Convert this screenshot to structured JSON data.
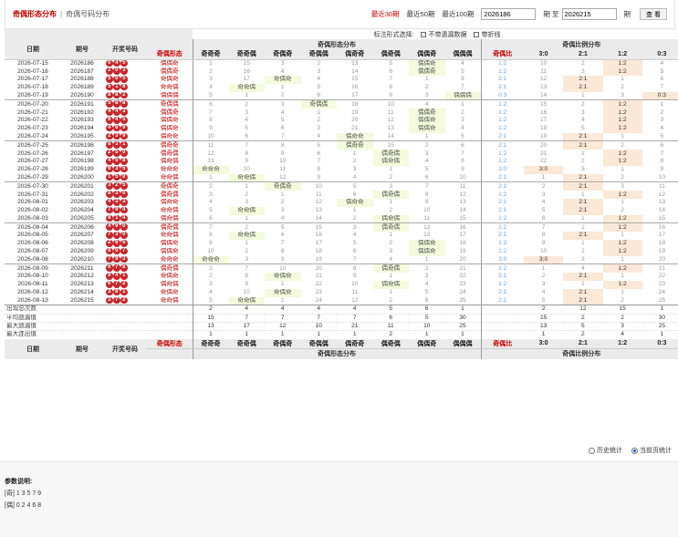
{
  "header": {
    "tab_active": "奇偶形态分布",
    "separator": "|",
    "tab_other": "奇偶号码分布",
    "range_30": "最近30期",
    "range_50": "最近50期",
    "range_100": "最近100期",
    "from_value": "2026186",
    "from_label": "期 至",
    "to_value": "2026215",
    "to_label": "期",
    "query_button": "查 看"
  },
  "columns": {
    "date": "日期",
    "issue": "期号",
    "balls": "开奖号码",
    "form": "奇偶形态",
    "form_group": "奇偶形态分布",
    "form_cols": [
      "奇奇奇",
      "奇奇偶",
      "奇偶奇",
      "奇偶偶",
      "偶奇奇",
      "偶奇偶",
      "偶偶奇",
      "偶偶偶"
    ],
    "ratio_group": "奇偶比例分布",
    "ratio": "奇偶比",
    "ratio_cols": [
      "3:0",
      "2:1",
      "1:2",
      "0:3"
    ]
  },
  "options": {
    "title": "标注形式选择:",
    "opt1": "不带遗漏数据",
    "opt2": "带折线"
  },
  "rows": [
    {
      "date": "2026-07-15",
      "issue": "2026186",
      "balls": [
        "0",
        "4",
        "5"
      ],
      "form": "偶偶奇",
      "f": [
        "1",
        "15",
        "3",
        "2",
        "13",
        "5",
        "偶偶奇",
        "4"
      ],
      "ratio": "1:2",
      "r": [
        "10",
        "2",
        "1:2",
        "4"
      ]
    },
    {
      "date": "2026-07-16",
      "issue": "2026187",
      "balls": [
        "2",
        "0",
        "3"
      ],
      "form": "偶偶奇",
      "f": [
        "2",
        "16",
        "4",
        "3",
        "14",
        "6",
        "偶偶奇",
        "5"
      ],
      "ratio": "1:2",
      "r": [
        "11",
        "3",
        "1:2",
        "5"
      ]
    },
    {
      "date": "2026-07-17",
      "issue": "2026188",
      "balls": [
        "5",
        "0",
        "5"
      ],
      "form": "奇偶奇",
      "f": [
        "3",
        "17",
        "奇偶奇",
        "4",
        "15",
        "7",
        "1",
        "6"
      ],
      "ratio": "2:1",
      "r": [
        "12",
        "2:1",
        "1",
        "6"
      ]
    },
    {
      "date": "2026-07-18",
      "issue": "2026189",
      "balls": [
        "5",
        "1",
        "8"
      ],
      "form": "奇奇偶",
      "f": [
        "4",
        "奇奇偶",
        "1",
        "5",
        "16",
        "8",
        "2",
        "7"
      ],
      "ratio": "2:1",
      "r": [
        "13",
        "2:1",
        "2",
        "7"
      ]
    },
    {
      "date": "2026-07-19",
      "issue": "2026190",
      "balls": [
        "8",
        "8",
        "2"
      ],
      "form": "偶偶偶",
      "f": [
        "5",
        "1",
        "2",
        "6",
        "17",
        "9",
        "3",
        "偶偶偶"
      ],
      "ratio": "0:3",
      "r": [
        "14",
        "1",
        "3",
        "0:3"
      ]
    },
    {
      "date": "2026-07-20",
      "issue": "2026191",
      "balls": [
        "5",
        "8",
        "8"
      ],
      "form": "奇偶偶",
      "f": [
        "6",
        "2",
        "3",
        "奇偶偶",
        "18",
        "10",
        "4",
        "1"
      ],
      "ratio": "1:2",
      "r": [
        "15",
        "2",
        "1:2",
        "1"
      ]
    },
    {
      "date": "2026-07-21",
      "issue": "2026192",
      "balls": [
        "4",
        "4",
        "3"
      ],
      "form": "偶偶奇",
      "f": [
        "7",
        "3",
        "4",
        "1",
        "19",
        "11",
        "偶偶奇",
        "2"
      ],
      "ratio": "1:2",
      "r": [
        "16",
        "3",
        "1:2",
        "2"
      ]
    },
    {
      "date": "2026-07-22",
      "issue": "2026193",
      "balls": [
        "6",
        "4",
        "5"
      ],
      "form": "偶偶奇",
      "f": [
        "8",
        "4",
        "5",
        "2",
        "20",
        "12",
        "偶偶奇",
        "3"
      ],
      "ratio": "1:2",
      "r": [
        "17",
        "4",
        "1:2",
        "3"
      ]
    },
    {
      "date": "2026-07-23",
      "issue": "2026194",
      "balls": [
        "4",
        "6",
        "9"
      ],
      "form": "偶偶奇",
      "f": [
        "9",
        "5",
        "6",
        "3",
        "21",
        "13",
        "偶偶奇",
        "4"
      ],
      "ratio": "1:2",
      "r": [
        "18",
        "5",
        "1:2",
        "4"
      ]
    },
    {
      "date": "2026-07-24",
      "issue": "2026195",
      "balls": [
        "2",
        "3",
        "9"
      ],
      "form": "偶奇奇",
      "f": [
        "10",
        "6",
        "7",
        "4",
        "偶奇奇",
        "14",
        "1",
        "5"
      ],
      "ratio": "2:1",
      "r": [
        "19",
        "2:1",
        "1",
        "5"
      ]
    },
    {
      "date": "2026-07-25",
      "issue": "2026196",
      "balls": [
        "8",
        "3",
        "1"
      ],
      "form": "偶奇奇",
      "f": [
        "11",
        "7",
        "8",
        "5",
        "偶奇奇",
        "15",
        "2",
        "6"
      ],
      "ratio": "2:1",
      "r": [
        "20",
        "2:1",
        "2",
        "6"
      ]
    },
    {
      "date": "2026-07-26",
      "issue": "2026197",
      "balls": [
        "2",
        "5",
        "0"
      ],
      "form": "偶奇偶",
      "f": [
        "12",
        "8",
        "9",
        "6",
        "1",
        "偶奇偶",
        "3",
        "7"
      ],
      "ratio": "1:2",
      "r": [
        "21",
        "1",
        "1:2",
        "7"
      ]
    },
    {
      "date": "2026-07-27",
      "issue": "2026198",
      "balls": [
        "4",
        "5",
        "8"
      ],
      "form": "偶奇偶",
      "f": [
        "13",
        "9",
        "10",
        "7",
        "2",
        "偶奇偶",
        "4",
        "8"
      ],
      "ratio": "1:2",
      "r": [
        "22",
        "2",
        "1:2",
        "8"
      ]
    },
    {
      "date": "2026-07-28",
      "issue": "2026199",
      "balls": [
        "9",
        "3",
        "5"
      ],
      "form": "奇奇奇",
      "f": [
        "奇奇奇",
        "10",
        "11",
        "8",
        "3",
        "1",
        "5",
        "9"
      ],
      "ratio": "3:0",
      "r": [
        "3:0",
        "3",
        "1",
        "9"
      ]
    },
    {
      "date": "2026-07-29",
      "issue": "2026200",
      "balls": [
        "1",
        "5",
        "0"
      ],
      "form": "奇奇偶",
      "f": [
        "1",
        "奇奇偶",
        "12",
        "9",
        "4",
        "2",
        "6",
        "10"
      ],
      "ratio": "2:1",
      "r": [
        "1",
        "2:1",
        "2",
        "10"
      ]
    },
    {
      "date": "2026-07-30",
      "issue": "2026201",
      "balls": [
        "3",
        "2",
        "5"
      ],
      "form": "奇偶奇",
      "f": [
        "2",
        "1",
        "奇偶奇",
        "10",
        "5",
        "3",
        "7",
        "11"
      ],
      "ratio": "2:1",
      "r": [
        "2",
        "2:1",
        "3",
        "11"
      ]
    },
    {
      "date": "2026-07-31",
      "issue": "2026202",
      "balls": [
        "8",
        "3",
        "0"
      ],
      "form": "偶奇偶",
      "f": [
        "3",
        "2",
        "1",
        "11",
        "6",
        "偶奇偶",
        "8",
        "12"
      ],
      "ratio": "1:2",
      "r": [
        "3",
        "1",
        "1:2",
        "12"
      ]
    },
    {
      "date": "2026-08-01",
      "issue": "2026203",
      "balls": [
        "4",
        "3",
        "3"
      ],
      "form": "偶奇奇",
      "f": [
        "4",
        "3",
        "2",
        "12",
        "偶奇奇",
        "1",
        "9",
        "13"
      ],
      "ratio": "2:1",
      "r": [
        "4",
        "2:1",
        "1",
        "13"
      ]
    },
    {
      "date": "2026-08-02",
      "issue": "2026204",
      "balls": [
        "7",
        "9",
        "4"
      ],
      "form": "奇奇偶",
      "f": [
        "5",
        "奇奇偶",
        "3",
        "13",
        "1",
        "2",
        "10",
        "14"
      ],
      "ratio": "2:1",
      "r": [
        "5",
        "2:1",
        "2",
        "14"
      ]
    },
    {
      "date": "2026-08-03",
      "issue": "2026205",
      "balls": [
        "8",
        "1",
        "4"
      ],
      "form": "偶奇偶",
      "f": [
        "6",
        "1",
        "4",
        "14",
        "2",
        "偶奇偶",
        "11",
        "15"
      ],
      "ratio": "1:2",
      "r": [
        "6",
        "1",
        "1:2",
        "15"
      ]
    },
    {
      "date": "2026-08-04",
      "issue": "2026206",
      "balls": [
        "4",
        "9",
        "0"
      ],
      "form": "偶奇偶",
      "f": [
        "7",
        "2",
        "5",
        "15",
        "3",
        "偶奇偶",
        "12",
        "16"
      ],
      "ratio": "1:2",
      "r": [
        "7",
        "2",
        "1:2",
        "16"
      ]
    },
    {
      "date": "2026-08-05",
      "issue": "2026207",
      "balls": [
        "7",
        "3",
        "0"
      ],
      "form": "奇奇偶",
      "f": [
        "8",
        "奇奇偶",
        "6",
        "16",
        "4",
        "1",
        "13",
        "17"
      ],
      "ratio": "2:1",
      "r": [
        "8",
        "2:1",
        "1",
        "17"
      ]
    },
    {
      "date": "2026-08-06",
      "issue": "2026208",
      "balls": [
        "2",
        "6",
        "5"
      ],
      "form": "偶偶奇",
      "f": [
        "9",
        "1",
        "7",
        "17",
        "5",
        "2",
        "偶偶奇",
        "18"
      ],
      "ratio": "1:2",
      "r": [
        "9",
        "1",
        "1:2",
        "18"
      ]
    },
    {
      "date": "2026-08-07",
      "issue": "2026209",
      "balls": [
        "8",
        "0",
        "7"
      ],
      "form": "偶偶奇",
      "f": [
        "10",
        "2",
        "8",
        "18",
        "6",
        "3",
        "偶偶奇",
        "19"
      ],
      "ratio": "1:2",
      "r": [
        "10",
        "2",
        "1:2",
        "19"
      ]
    },
    {
      "date": "2026-08-08",
      "issue": "2026210",
      "balls": [
        "7",
        "9",
        "3"
      ],
      "form": "奇奇奇",
      "f": [
        "奇奇奇",
        "3",
        "9",
        "19",
        "7",
        "4",
        "1",
        "20"
      ],
      "ratio": "3:0",
      "r": [
        "3:0",
        "3",
        "1",
        "20"
      ]
    },
    {
      "date": "2026-08-09",
      "issue": "2026211",
      "balls": [
        "6",
        "7",
        "8"
      ],
      "form": "偶奇偶",
      "f": [
        "1",
        "7",
        "10",
        "20",
        "8",
        "偶奇偶",
        "2",
        "21"
      ],
      "ratio": "1:2",
      "r": [
        "1",
        "4",
        "1:2",
        "21"
      ]
    },
    {
      "date": "2026-08-10",
      "issue": "2026212",
      "balls": [
        "9",
        "4",
        "1"
      ],
      "form": "奇偶奇",
      "f": [
        "2",
        "8",
        "奇偶奇",
        "21",
        "9",
        "1",
        "3",
        "22"
      ],
      "ratio": "2:1",
      "r": [
        "2",
        "2:1",
        "1",
        "22"
      ]
    },
    {
      "date": "2026-08-11",
      "issue": "2026213",
      "balls": [
        "6",
        "7",
        "2"
      ],
      "form": "偶奇偶",
      "f": [
        "3",
        "9",
        "1",
        "22",
        "10",
        "偶奇偶",
        "4",
        "23"
      ],
      "ratio": "1:2",
      "r": [
        "3",
        "1",
        "1:2",
        "23"
      ]
    },
    {
      "date": "2026-08-12",
      "issue": "2026214",
      "balls": [
        "3",
        "8",
        "1"
      ],
      "form": "奇偶奇",
      "f": [
        "4",
        "10",
        "奇偶奇",
        "23",
        "11",
        "1",
        "5",
        "24"
      ],
      "ratio": "2:1",
      "r": [
        "4",
        "2:1",
        "1",
        "24"
      ]
    },
    {
      "date": "2026-08-13",
      "issue": "2026215",
      "balls": [
        "3",
        "7",
        "2"
      ],
      "form": "奇奇偶",
      "f": [
        "5",
        "奇奇偶",
        "1",
        "24",
        "12",
        "2",
        "6",
        "25"
      ],
      "ratio": "2:1",
      "r": [
        "5",
        "2:1",
        "2",
        "25"
      ]
    }
  ],
  "stats": [
    {
      "label": "出现总次数",
      "f": [
        "2",
        "4",
        "4",
        "4",
        "4",
        "5",
        "6",
        "1"
      ],
      "r": [
        "2",
        "12",
        "15",
        "1"
      ]
    },
    {
      "label": "平均遗漏值",
      "f": [
        "15",
        "7",
        "7",
        "7",
        "7",
        "6",
        "5",
        "30"
      ],
      "r": [
        "15",
        "2",
        "2",
        "30"
      ]
    },
    {
      "label": "最大遗漏值",
      "f": [
        "13",
        "17",
        "12",
        "10",
        "21",
        "11",
        "10",
        "25"
      ],
      "r": [
        "13",
        "5",
        "3",
        "25"
      ]
    },
    {
      "label": "最大连出值",
      "f": [
        "1",
        "1",
        "1",
        "1",
        "1",
        "2",
        "1",
        "1"
      ],
      "r": [
        "1",
        "2",
        "4",
        "1"
      ]
    }
  ],
  "footer": {
    "opt_history": "历史统计",
    "opt_current": "当前页统计"
  },
  "description": {
    "title": "参数说明:",
    "odd": "[奇]  1 3 5 7 9",
    "even": "[偶]  0 2 4 6 8"
  }
}
